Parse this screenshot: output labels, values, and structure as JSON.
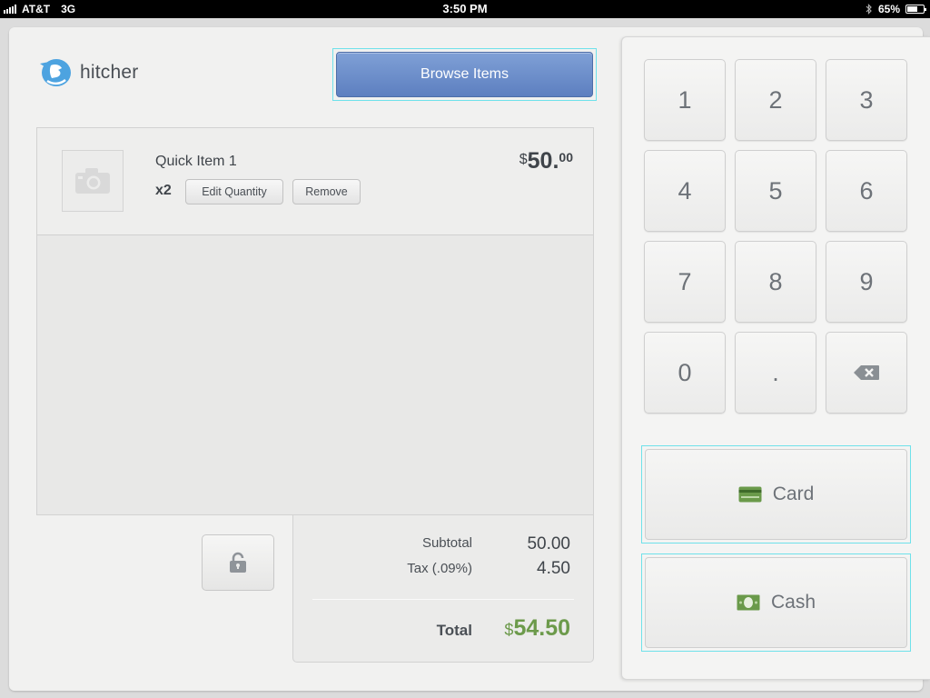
{
  "status_bar": {
    "carrier": "AT&T",
    "network": "3G",
    "time": "3:50 PM",
    "battery": "65%",
    "battery_level": 0.65
  },
  "app": {
    "logo_text": "hitcher",
    "browse_label": "Browse Items"
  },
  "cart": {
    "items": [
      {
        "name": "Quick Item 1",
        "quantity": "x2",
        "edit_label": "Edit Quantity",
        "remove_label": "Remove",
        "price_currency": "$",
        "price_whole": "50.",
        "price_cents": "00"
      }
    ]
  },
  "totals": {
    "subtotal_label": "Subtotal",
    "subtotal_value": "50.00",
    "tax_label": "Tax (.09%)",
    "tax_value": "4.50",
    "total_label": "Total",
    "total_currency": "$",
    "total_value": "54.50"
  },
  "keypad": {
    "keys": [
      "1",
      "2",
      "3",
      "4",
      "5",
      "6",
      "7",
      "8",
      "9",
      "0",
      ".",
      "backspace-icon"
    ]
  },
  "payment": {
    "card_label": "Card",
    "cash_label": "Cash"
  },
  "colors": {
    "accent_blue": "#6a8ccb",
    "total_green": "#6c9a4b",
    "selection_cyan": "#6fe1ea"
  }
}
